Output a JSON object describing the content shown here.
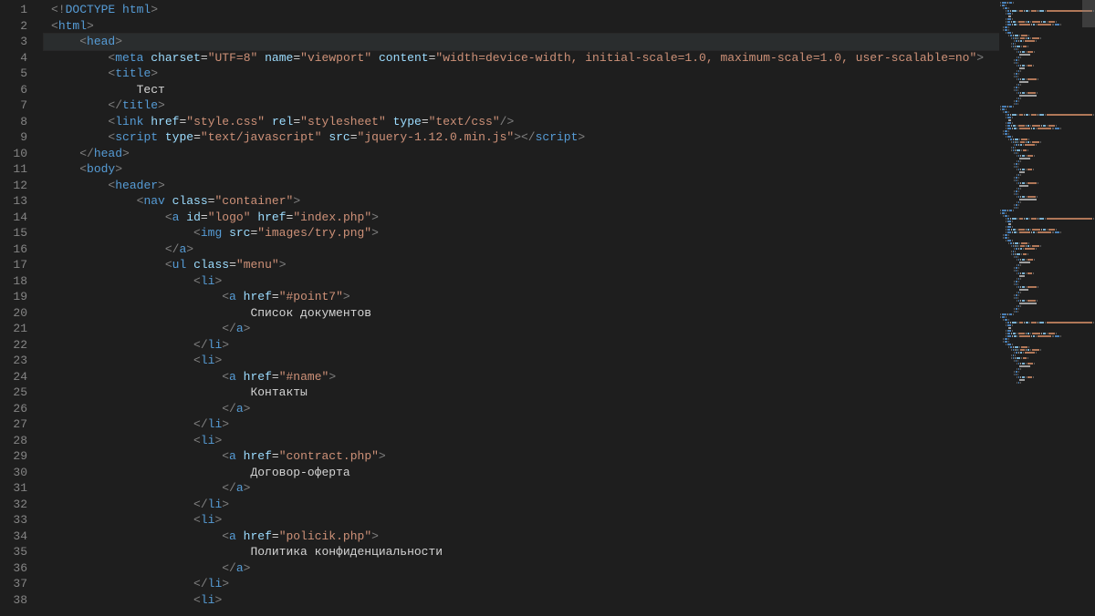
{
  "editor": {
    "lineStart": 1,
    "lineEnd": 38,
    "currentLine": 3,
    "lines": [
      {
        "n": 1,
        "indent": 0,
        "tokens": [
          {
            "c": "punc",
            "t": "<!"
          },
          {
            "c": "tag",
            "t": "DOCTYPE"
          },
          {
            "c": "text",
            "t": " "
          },
          {
            "c": "htmlkw",
            "t": "html"
          },
          {
            "c": "punc",
            "t": ">"
          }
        ]
      },
      {
        "n": 2,
        "indent": 0,
        "tokens": [
          {
            "c": "punc",
            "t": "<"
          },
          {
            "c": "tag",
            "t": "html"
          },
          {
            "c": "punc",
            "t": ">"
          }
        ]
      },
      {
        "n": 3,
        "indent": 1,
        "tokens": [
          {
            "c": "punc",
            "t": "<"
          },
          {
            "c": "tag",
            "t": "head"
          },
          {
            "c": "punc",
            "t": ">"
          }
        ]
      },
      {
        "n": 4,
        "indent": 2,
        "tokens": [
          {
            "c": "punc",
            "t": "<"
          },
          {
            "c": "tag",
            "t": "meta"
          },
          {
            "c": "text",
            "t": " "
          },
          {
            "c": "attr",
            "t": "charset"
          },
          {
            "c": "eq",
            "t": "="
          },
          {
            "c": "str",
            "t": "\"UTF=8\""
          },
          {
            "c": "text",
            "t": " "
          },
          {
            "c": "attr",
            "t": "name"
          },
          {
            "c": "eq",
            "t": "="
          },
          {
            "c": "str",
            "t": "\"viewport\""
          },
          {
            "c": "text",
            "t": " "
          },
          {
            "c": "attr",
            "t": "content"
          },
          {
            "c": "eq",
            "t": "="
          },
          {
            "c": "str",
            "t": "\"width=device-width, initial-scale=1.0, maximum-scale=1.0, user-scalable=no\""
          },
          {
            "c": "punc",
            "t": ">"
          }
        ]
      },
      {
        "n": 5,
        "indent": 2,
        "tokens": [
          {
            "c": "punc",
            "t": "<"
          },
          {
            "c": "tag",
            "t": "title"
          },
          {
            "c": "punc",
            "t": ">"
          }
        ]
      },
      {
        "n": 6,
        "indent": 3,
        "tokens": [
          {
            "c": "text",
            "t": "Тест"
          }
        ]
      },
      {
        "n": 7,
        "indent": 2,
        "tokens": [
          {
            "c": "punc",
            "t": "</"
          },
          {
            "c": "tag",
            "t": "title"
          },
          {
            "c": "punc",
            "t": ">"
          }
        ]
      },
      {
        "n": 8,
        "indent": 2,
        "tokens": [
          {
            "c": "punc",
            "t": "<"
          },
          {
            "c": "tag",
            "t": "link"
          },
          {
            "c": "text",
            "t": " "
          },
          {
            "c": "attr",
            "t": "href"
          },
          {
            "c": "eq",
            "t": "="
          },
          {
            "c": "str",
            "t": "\"style.css\""
          },
          {
            "c": "text",
            "t": " "
          },
          {
            "c": "attr",
            "t": "rel"
          },
          {
            "c": "eq",
            "t": "="
          },
          {
            "c": "str",
            "t": "\"stylesheet\""
          },
          {
            "c": "text",
            "t": " "
          },
          {
            "c": "attr",
            "t": "type"
          },
          {
            "c": "eq",
            "t": "="
          },
          {
            "c": "str",
            "t": "\"text/css\""
          },
          {
            "c": "punc",
            "t": "/>"
          }
        ]
      },
      {
        "n": 9,
        "indent": 2,
        "tokens": [
          {
            "c": "punc",
            "t": "<"
          },
          {
            "c": "tag",
            "t": "script"
          },
          {
            "c": "text",
            "t": " "
          },
          {
            "c": "attr",
            "t": "type"
          },
          {
            "c": "eq",
            "t": "="
          },
          {
            "c": "str",
            "t": "\"text/javascript\""
          },
          {
            "c": "text",
            "t": " "
          },
          {
            "c": "attr",
            "t": "src"
          },
          {
            "c": "eq",
            "t": "="
          },
          {
            "c": "str",
            "t": "\"jquery-1.12.0.min.js\""
          },
          {
            "c": "punc",
            "t": "></"
          },
          {
            "c": "tag",
            "t": "script"
          },
          {
            "c": "punc",
            "t": ">"
          }
        ]
      },
      {
        "n": 10,
        "indent": 1,
        "tokens": [
          {
            "c": "punc",
            "t": "</"
          },
          {
            "c": "tag",
            "t": "head"
          },
          {
            "c": "punc",
            "t": ">"
          }
        ]
      },
      {
        "n": 11,
        "indent": 1,
        "tokens": [
          {
            "c": "punc",
            "t": "<"
          },
          {
            "c": "tag",
            "t": "body"
          },
          {
            "c": "punc",
            "t": ">"
          }
        ]
      },
      {
        "n": 12,
        "indent": 2,
        "tokens": [
          {
            "c": "punc",
            "t": "<"
          },
          {
            "c": "tag",
            "t": "header"
          },
          {
            "c": "punc",
            "t": ">"
          }
        ]
      },
      {
        "n": 13,
        "indent": 3,
        "tokens": [
          {
            "c": "punc",
            "t": "<"
          },
          {
            "c": "tag",
            "t": "nav"
          },
          {
            "c": "text",
            "t": " "
          },
          {
            "c": "attr",
            "t": "class"
          },
          {
            "c": "eq",
            "t": "="
          },
          {
            "c": "str",
            "t": "\"container\""
          },
          {
            "c": "punc",
            "t": ">"
          }
        ]
      },
      {
        "n": 14,
        "indent": 4,
        "tokens": [
          {
            "c": "punc",
            "t": "<"
          },
          {
            "c": "tag",
            "t": "a"
          },
          {
            "c": "text",
            "t": " "
          },
          {
            "c": "attr",
            "t": "id"
          },
          {
            "c": "eq",
            "t": "="
          },
          {
            "c": "str",
            "t": "\"logo\""
          },
          {
            "c": "text",
            "t": " "
          },
          {
            "c": "attr",
            "t": "href"
          },
          {
            "c": "eq",
            "t": "="
          },
          {
            "c": "str",
            "t": "\"index.php\""
          },
          {
            "c": "punc",
            "t": ">"
          }
        ]
      },
      {
        "n": 15,
        "indent": 5,
        "tokens": [
          {
            "c": "punc",
            "t": "<"
          },
          {
            "c": "tag",
            "t": "img"
          },
          {
            "c": "text",
            "t": " "
          },
          {
            "c": "attr",
            "t": "src"
          },
          {
            "c": "eq",
            "t": "="
          },
          {
            "c": "str",
            "t": "\"images/try.png\""
          },
          {
            "c": "punc",
            "t": ">"
          }
        ]
      },
      {
        "n": 16,
        "indent": 4,
        "tokens": [
          {
            "c": "punc",
            "t": "</"
          },
          {
            "c": "tag",
            "t": "a"
          },
          {
            "c": "punc",
            "t": ">"
          }
        ]
      },
      {
        "n": 17,
        "indent": 4,
        "tokens": [
          {
            "c": "punc",
            "t": "<"
          },
          {
            "c": "tag",
            "t": "ul"
          },
          {
            "c": "text",
            "t": " "
          },
          {
            "c": "attr",
            "t": "class"
          },
          {
            "c": "eq",
            "t": "="
          },
          {
            "c": "str",
            "t": "\"menu\""
          },
          {
            "c": "punc",
            "t": ">"
          }
        ]
      },
      {
        "n": 18,
        "indent": 5,
        "tokens": [
          {
            "c": "punc",
            "t": "<"
          },
          {
            "c": "tag",
            "t": "li"
          },
          {
            "c": "punc",
            "t": ">"
          }
        ]
      },
      {
        "n": 19,
        "indent": 6,
        "tokens": [
          {
            "c": "punc",
            "t": "<"
          },
          {
            "c": "tag",
            "t": "a"
          },
          {
            "c": "text",
            "t": " "
          },
          {
            "c": "attr",
            "t": "href"
          },
          {
            "c": "eq",
            "t": "="
          },
          {
            "c": "str",
            "t": "\"#point7\""
          },
          {
            "c": "punc",
            "t": ">"
          }
        ]
      },
      {
        "n": 20,
        "indent": 7,
        "tokens": [
          {
            "c": "text",
            "t": "Список документов"
          }
        ]
      },
      {
        "n": 21,
        "indent": 6,
        "tokens": [
          {
            "c": "punc",
            "t": "</"
          },
          {
            "c": "tag",
            "t": "a"
          },
          {
            "c": "punc",
            "t": ">"
          }
        ]
      },
      {
        "n": 22,
        "indent": 5,
        "tokens": [
          {
            "c": "punc",
            "t": "</"
          },
          {
            "c": "tag",
            "t": "li"
          },
          {
            "c": "punc",
            "t": ">"
          }
        ]
      },
      {
        "n": 23,
        "indent": 5,
        "tokens": [
          {
            "c": "punc",
            "t": "<"
          },
          {
            "c": "tag",
            "t": "li"
          },
          {
            "c": "punc",
            "t": ">"
          }
        ]
      },
      {
        "n": 24,
        "indent": 6,
        "tokens": [
          {
            "c": "punc",
            "t": "<"
          },
          {
            "c": "tag",
            "t": "a"
          },
          {
            "c": "text",
            "t": " "
          },
          {
            "c": "attr",
            "t": "href"
          },
          {
            "c": "eq",
            "t": "="
          },
          {
            "c": "str",
            "t": "\"#name\""
          },
          {
            "c": "punc",
            "t": ">"
          }
        ]
      },
      {
        "n": 25,
        "indent": 7,
        "tokens": [
          {
            "c": "text",
            "t": "Контакты"
          }
        ]
      },
      {
        "n": 26,
        "indent": 6,
        "tokens": [
          {
            "c": "punc",
            "t": "</"
          },
          {
            "c": "tag",
            "t": "a"
          },
          {
            "c": "punc",
            "t": ">"
          }
        ]
      },
      {
        "n": 27,
        "indent": 5,
        "tokens": [
          {
            "c": "punc",
            "t": "</"
          },
          {
            "c": "tag",
            "t": "li"
          },
          {
            "c": "punc",
            "t": ">"
          }
        ]
      },
      {
        "n": 28,
        "indent": 5,
        "tokens": [
          {
            "c": "punc",
            "t": "<"
          },
          {
            "c": "tag",
            "t": "li"
          },
          {
            "c": "punc",
            "t": ">"
          }
        ]
      },
      {
        "n": 29,
        "indent": 6,
        "tokens": [
          {
            "c": "punc",
            "t": "<"
          },
          {
            "c": "tag",
            "t": "a"
          },
          {
            "c": "text",
            "t": " "
          },
          {
            "c": "attr",
            "t": "href"
          },
          {
            "c": "eq",
            "t": "="
          },
          {
            "c": "str",
            "t": "\"contract.php\""
          },
          {
            "c": "punc",
            "t": ">"
          }
        ]
      },
      {
        "n": 30,
        "indent": 7,
        "tokens": [
          {
            "c": "text",
            "t": "Договор-оферта"
          }
        ]
      },
      {
        "n": 31,
        "indent": 6,
        "tokens": [
          {
            "c": "punc",
            "t": "</"
          },
          {
            "c": "tag",
            "t": "a"
          },
          {
            "c": "punc",
            "t": ">"
          }
        ]
      },
      {
        "n": 32,
        "indent": 5,
        "tokens": [
          {
            "c": "punc",
            "t": "</"
          },
          {
            "c": "tag",
            "t": "li"
          },
          {
            "c": "punc",
            "t": ">"
          }
        ]
      },
      {
        "n": 33,
        "indent": 5,
        "tokens": [
          {
            "c": "punc",
            "t": "<"
          },
          {
            "c": "tag",
            "t": "li"
          },
          {
            "c": "punc",
            "t": ">"
          }
        ]
      },
      {
        "n": 34,
        "indent": 6,
        "tokens": [
          {
            "c": "punc",
            "t": "<"
          },
          {
            "c": "tag",
            "t": "a"
          },
          {
            "c": "text",
            "t": " "
          },
          {
            "c": "attr",
            "t": "href"
          },
          {
            "c": "eq",
            "t": "="
          },
          {
            "c": "str",
            "t": "\"policik.php\""
          },
          {
            "c": "punc",
            "t": ">"
          }
        ]
      },
      {
        "n": 35,
        "indent": 7,
        "tokens": [
          {
            "c": "text",
            "t": "Политика конфиденциальности"
          }
        ]
      },
      {
        "n": 36,
        "indent": 6,
        "tokens": [
          {
            "c": "punc",
            "t": "</"
          },
          {
            "c": "tag",
            "t": "a"
          },
          {
            "c": "punc",
            "t": ">"
          }
        ]
      },
      {
        "n": 37,
        "indent": 5,
        "tokens": [
          {
            "c": "punc",
            "t": "</"
          },
          {
            "c": "tag",
            "t": "li"
          },
          {
            "c": "punc",
            "t": ">"
          }
        ]
      },
      {
        "n": 38,
        "indent": 5,
        "tokens": [
          {
            "c": "punc",
            "t": "<"
          },
          {
            "c": "tag",
            "t": "li"
          },
          {
            "c": "punc",
            "t": ">"
          }
        ]
      }
    ]
  }
}
